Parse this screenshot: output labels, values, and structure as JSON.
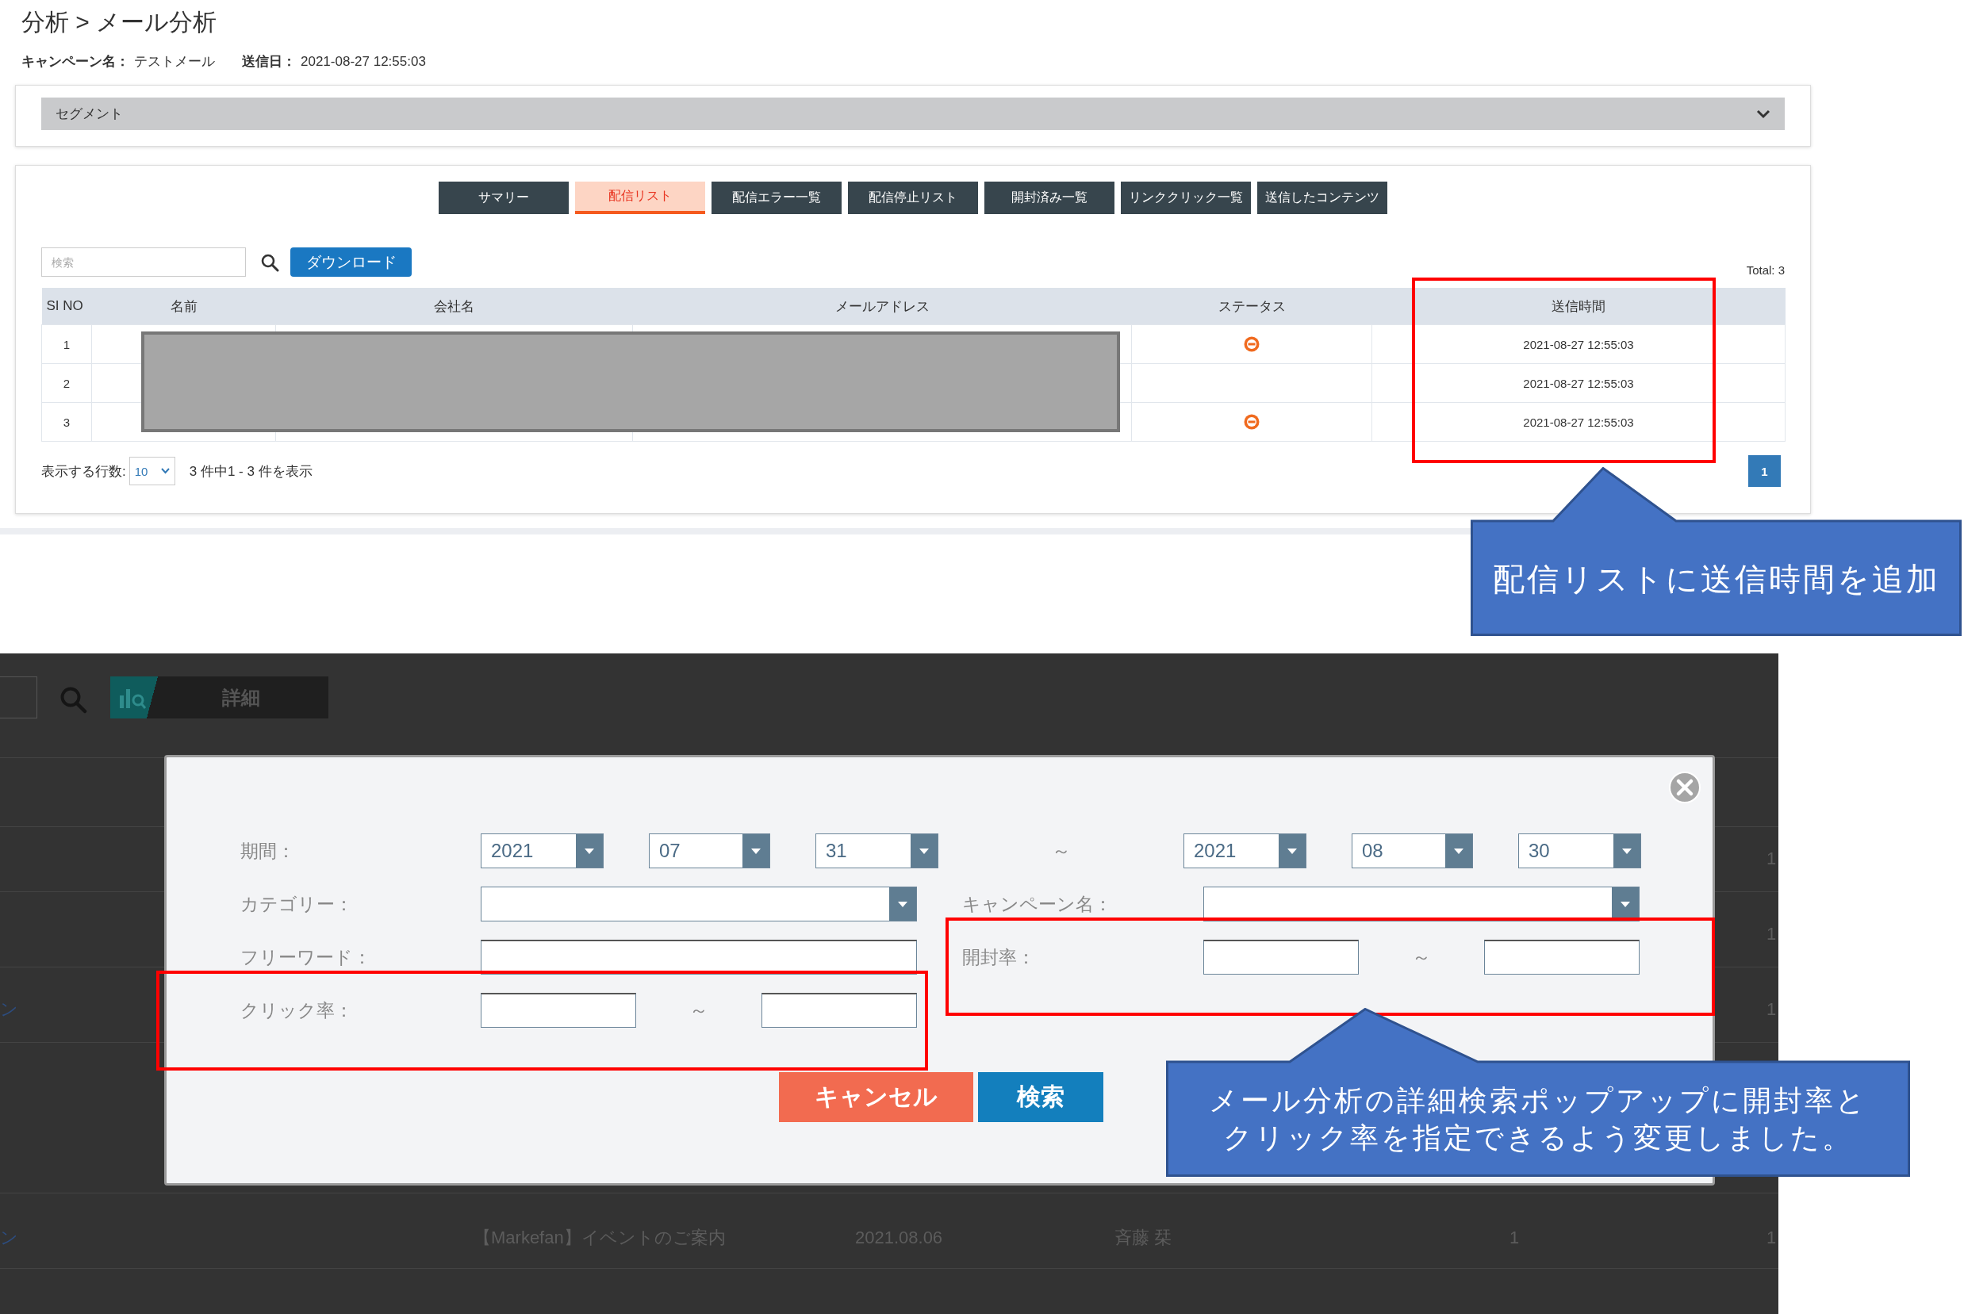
{
  "top_screen": {
    "breadcrumb": "分析 > メール分析",
    "campaign_label": "キャンペーン名：",
    "campaign_value": "テストメール",
    "sent_label": "送信日：",
    "sent_value": "2021-08-27 12:55:03",
    "segment": {
      "label": "セグメント",
      "expanded": false
    },
    "tabs": [
      {
        "label": "サマリー",
        "selected": false
      },
      {
        "label": "配信リスト",
        "selected": true
      },
      {
        "label": "配信エラー一覧",
        "selected": false
      },
      {
        "label": "配信停止リスト",
        "selected": false
      },
      {
        "label": "開封済み一覧",
        "selected": false
      },
      {
        "label": "リンククリック一覧",
        "selected": false
      },
      {
        "label": "送信したコンテンツ",
        "selected": false
      }
    ],
    "search": {
      "placeholder": "検索"
    },
    "download_button": "ダウンロード",
    "total": "Total: 3",
    "table": {
      "columns": [
        "SI NO",
        "名前",
        "会社名",
        "メールアドレス",
        "ステータス",
        "送信時間"
      ],
      "rows": [
        {
          "no": "1",
          "status_icon": true,
          "sent_time": "2021-08-27 12:55:03"
        },
        {
          "no": "2",
          "status_icon": false,
          "sent_time": "2021-08-27 12:55:03"
        },
        {
          "no": "3",
          "status_icon": true,
          "sent_time": "2021-08-27 12:55:03"
        }
      ]
    },
    "rows_per_page_label": "表示する行数:",
    "rows_per_page": "10",
    "range_text": "3 件中1 - 3 件を表示",
    "pages": [
      {
        "label": "1",
        "selected": true
      }
    ]
  },
  "bottom_screen": {
    "detail_button": "詳細",
    "background_rows": [
      {
        "column_6": "1"
      },
      {
        "column_6": "1"
      },
      {
        "title_tail": "ン",
        "column_6": "1"
      },
      {
        "title_tail": "ン",
        "subject": "【Markefan】イベントのご案内",
        "date": "2021.08.06",
        "sender": "斉藤 栞",
        "count": "1",
        "column_6": "1"
      }
    ],
    "modal": {
      "period_label": "期間：",
      "period_from": [
        "2021",
        "07",
        "31"
      ],
      "period_separator": "～",
      "period_to": [
        "2021",
        "08",
        "30"
      ],
      "category_label": "カテゴリー：",
      "campaign_label": "キャンペーン名：",
      "freeword_label": "フリーワード：",
      "open_rate_label": "開封率：",
      "open_rate_separator": "～",
      "click_rate_label": "クリック率：",
      "click_rate_separator": "～",
      "cancel_button": "キャンセル",
      "search_button": "検索"
    }
  },
  "annotations": [
    {
      "text": "配信リストに送信時間を追加"
    },
    {
      "text": "メール分析の詳細検索ポップアップに開封率とクリック率を指定できるよう変更しました。"
    }
  ]
}
